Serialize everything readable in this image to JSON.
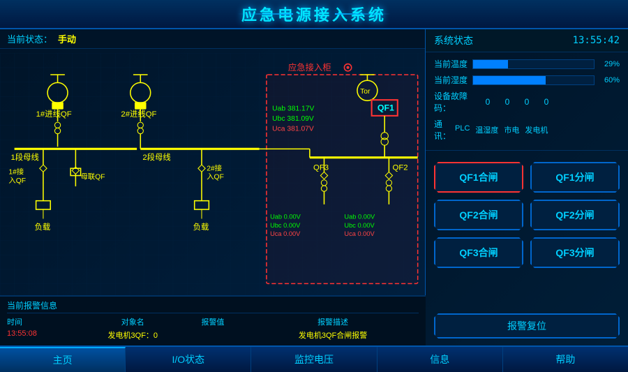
{
  "header": {
    "title": "应急电源接入系统"
  },
  "status_bar": {
    "label": "当前状态：",
    "value": "手动"
  },
  "sys_status": {
    "title": "系统状态",
    "time": "13:55:42",
    "temp_label": "当前温度",
    "temp_value": "29%",
    "temp_percent": 29,
    "humidity_label": "当前湿度",
    "humidity_value": "60%",
    "humidity_percent": 60,
    "fault_label": "设备故障码：",
    "fault_values": [
      "0",
      "0",
      "0",
      "0"
    ],
    "comm_label": "通  讯：",
    "comm_items": [
      "PLC",
      "温湿度",
      "市电",
      "发电机"
    ]
  },
  "emergency_box": {
    "label": "应急接入柜",
    "Uab1_label": "Uab",
    "Uab1_value": "381.17V",
    "Ubc1_label": "Ubc",
    "Ubc1_value": "381.09V",
    "Uca1_label": "Uca",
    "Uca1_value": "381.07V",
    "QF1_label": "QF1",
    "Uab2_label": "Uab",
    "Uab2_value": "0.00V",
    "Ubc2_label": "Ubc",
    "Ubc2_value": "0.00V",
    "Uca2_label": "Uca",
    "Uca2_value": "0.00V",
    "Uab3_label": "Uab",
    "Uab3_value": "0.00V",
    "Ubc3_label": "Ubc",
    "Ubc3_value": "0.00V",
    "Uca3_label": "Uca",
    "Uca3_value": "0.00V",
    "QF3_label": "QF3",
    "QF2_label": "QF2"
  },
  "schematic": {
    "labels": {
      "feeder1": "1#进线QF",
      "feeder2": "2#进线QF",
      "busbar1": "1段母线",
      "busbar2": "2段母线",
      "link1": "1#接\n入QF",
      "link2": "2#接\n入QF",
      "buslink": "母联QF",
      "load1": "负载",
      "load2": "负载"
    }
  },
  "buttons": {
    "qf1_close": "QF1合闸",
    "qf1_open": "QF1分闸",
    "qf2_close": "QF2合闸",
    "qf2_open": "QF2分闸",
    "qf3_close": "QF3合闸",
    "qf3_open": "QF3分闸",
    "alarm_reset": "报警复位"
  },
  "alarm": {
    "header": "当前报警信息",
    "cols": [
      "时间",
      "对象名",
      "报警值",
      "报警描述"
    ],
    "rows": [
      {
        "time": "13:55:08",
        "object": "发电机3QF",
        "value": "0",
        "desc": "发电机3QF合闸报警"
      }
    ]
  },
  "nav": {
    "items": [
      "主页",
      "I/O状态",
      "监控电压",
      "信息",
      "帮助"
    ],
    "active": 0
  }
}
